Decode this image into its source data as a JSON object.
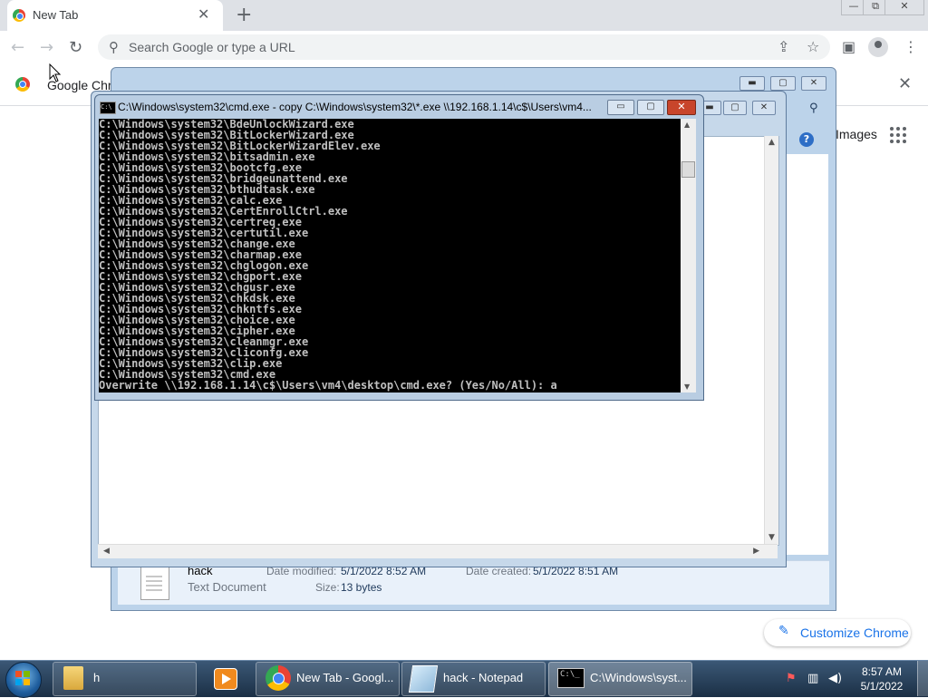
{
  "chrome": {
    "tab_title": "New Tab",
    "tab_close": "✕",
    "new_tab": "+",
    "win_minimize": "—",
    "win_restore": "⧉",
    "win_close": "✕",
    "back": "←",
    "forward": "→",
    "reload": "↻",
    "omnibox_placeholder": "Search Google or type a URL",
    "share": "⇪",
    "star": "☆",
    "sidepanel": "▣",
    "menu": "⋮",
    "bookmark_label": "Google Chro",
    "bookmark_close": "✕",
    "ntp_images": "Images",
    "customize_label": "Customize Chrome",
    "customize_icon": "✎"
  },
  "explorer": {
    "file_name": "hack",
    "file_type": "Text Document",
    "date_modified_label": "Date modified:",
    "date_modified": "5/1/2022 8:52 AM",
    "date_created_label": "Date created:",
    "date_created": "5/1/2022 8:51 AM",
    "size_label": "Size:",
    "size": "13 bytes",
    "help": "?"
  },
  "cmd": {
    "title": "C:\\Windows\\system32\\cmd.exe - copy  C:\\Windows\\system32\\*.exe  \\\\192.168.1.14\\c$\\Users\\vm4...",
    "icon_text": "C:\\",
    "lines": "C:\\Windows\\system32\\BdeUnlockWizard.exe\nC:\\Windows\\system32\\BitLockerWizard.exe\nC:\\Windows\\system32\\BitLockerWizardElev.exe\nC:\\Windows\\system32\\bitsadmin.exe\nC:\\Windows\\system32\\bootcfg.exe\nC:\\Windows\\system32\\bridgeunattend.exe\nC:\\Windows\\system32\\bthudtask.exe\nC:\\Windows\\system32\\calc.exe\nC:\\Windows\\system32\\CertEnrollCtrl.exe\nC:\\Windows\\system32\\certreq.exe\nC:\\Windows\\system32\\certutil.exe\nC:\\Windows\\system32\\change.exe\nC:\\Windows\\system32\\charmap.exe\nC:\\Windows\\system32\\chglogon.exe\nC:\\Windows\\system32\\chgport.exe\nC:\\Windows\\system32\\chgusr.exe\nC:\\Windows\\system32\\chkdsk.exe\nC:\\Windows\\system32\\chkntfs.exe\nC:\\Windows\\system32\\choice.exe\nC:\\Windows\\system32\\cipher.exe\nC:\\Windows\\system32\\cleanmgr.exe\nC:\\Windows\\system32\\cliconfg.exe\nC:\\Windows\\system32\\clip.exe\nC:\\Windows\\system32\\cmd.exe\nOverwrite \\\\192.168.1.14\\c$\\Users\\vm4\\desktop\\cmd.exe? (Yes/No/All): a",
    "minimize": "▭",
    "maximize": "▢",
    "close": "✕"
  },
  "taskbar": {
    "items": [
      {
        "label": "h"
      },
      {
        "label": "New Tab - Googl..."
      },
      {
        "label": "hack - Notepad"
      },
      {
        "label": "C:\\Windows\\syst..."
      }
    ],
    "cmd_icon_text": "C:\\_",
    "time": "8:57 AM",
    "date": "5/1/2022",
    "tray_flag": "⚑",
    "tray_network": "▥",
    "tray_volume": "◀)"
  },
  "colors": {
    "start_flag": [
      "#f25022",
      "#7fba00",
      "#00a4ef",
      "#ffb900"
    ]
  }
}
